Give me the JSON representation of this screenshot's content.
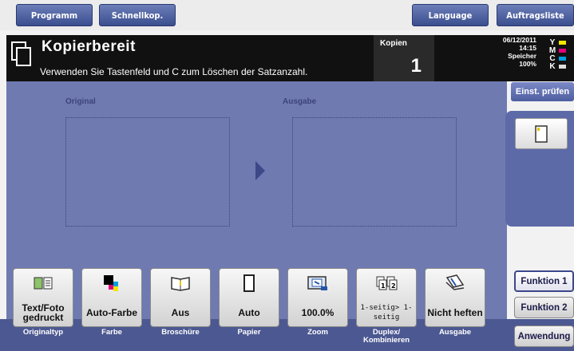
{
  "topbar": {
    "programm": "Programm",
    "schnellkop": "Schnellkop.",
    "language": "Language",
    "auftragsliste": "Auftragsliste"
  },
  "header": {
    "title": "Kopierbereit",
    "message": "Verwenden Sie Tastenfeld und C zum Löschen der Satzanzahl.",
    "kopien_label": "Kopien",
    "kopien_count": "1",
    "date": "06/12/2011",
    "time": "14:15",
    "speicher_label": "Speicher",
    "speicher_value": "100%",
    "toner": [
      {
        "letter": "Y",
        "color": "#f2e600"
      },
      {
        "letter": "M",
        "color": "#e0007a"
      },
      {
        "letter": "C",
        "color": "#00a0e0"
      },
      {
        "letter": "K",
        "color": "#222222"
      }
    ]
  },
  "main": {
    "original_label": "Original",
    "ausgabe_label": "Ausgabe"
  },
  "right": {
    "einst_pruefen": "Einst. prüfen",
    "funktion1": "Funktion 1",
    "funktion2": "Funktion 2",
    "anwendung": "Anwendung"
  },
  "functions": [
    {
      "value": "Text/Foto gedruckt",
      "label": "Originaltyp",
      "icon": "original-type-icon"
    },
    {
      "value": "Auto-Farbe",
      "label": "Farbe",
      "icon": "color-icon"
    },
    {
      "value": "Aus",
      "label": "Broschüre",
      "icon": "booklet-icon"
    },
    {
      "value": "Auto",
      "label": "Papier",
      "icon": "paper-icon"
    },
    {
      "value": "100.0%",
      "label": "Zoom",
      "icon": "zoom-icon"
    },
    {
      "value": "1-seitig> 1-seitig",
      "label": "Duplex/ Kombinieren",
      "icon": "duplex-icon"
    },
    {
      "value": "Nicht heften",
      "label": "Ausgabe",
      "icon": "staple-icon"
    }
  ],
  "colors": {
    "panel": "#6f7ab1",
    "accent": "#3a4d8e"
  }
}
